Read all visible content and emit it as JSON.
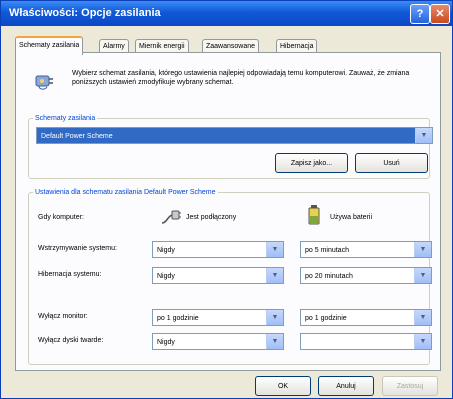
{
  "window": {
    "title": "Właściwości: Opcje zasilania",
    "help": "?",
    "close": "✕"
  },
  "tabs": [
    "Schematy zasilania",
    "Alarmy",
    "Miernik energii",
    "Zaawansowane",
    "Hibernacja"
  ],
  "intro": {
    "icon": "power-plug-icon",
    "text": "Wybierz schemat zasilania, którego ustawienia najlepiej odpowiadają temu komputerowi. Zauważ, że zmiana poniższych ustawień zmodyfikuje wybrany schemat."
  },
  "schemes": {
    "group_label": "Schematy zasilania",
    "selected": "Default Power Scheme",
    "save_as": "Zapisz jako...",
    "delete": "Usuń"
  },
  "settings": {
    "group_label": "Ustawienia dla schematu zasilania Default Power Scheme",
    "when_computer": "Gdy komputer:",
    "plugged_in": "Jest podłączony",
    "on_battery": "Używa baterii",
    "rows": [
      {
        "label": "Wstrzymywanie systemu:",
        "ac": "Nigdy",
        "dc": "po 5 minutach"
      },
      {
        "label": "Hibernacja systemu:",
        "ac": "Nigdy",
        "dc": "po 20 minutach"
      },
      {
        "label": "Wyłącz monitor:",
        "ac": "po 1 godzinie",
        "dc": "po 1 godzinie"
      },
      {
        "label": "Wyłącz dyski twarde:",
        "ac": "Nigdy",
        "dc": ""
      }
    ]
  },
  "buttons": {
    "ok": "OK",
    "cancel": "Anuluj",
    "apply": "Zastosuj"
  },
  "colors": {
    "title_bar": "#1159d8",
    "group_label": "#0046d5",
    "selection": "#316ac5"
  }
}
